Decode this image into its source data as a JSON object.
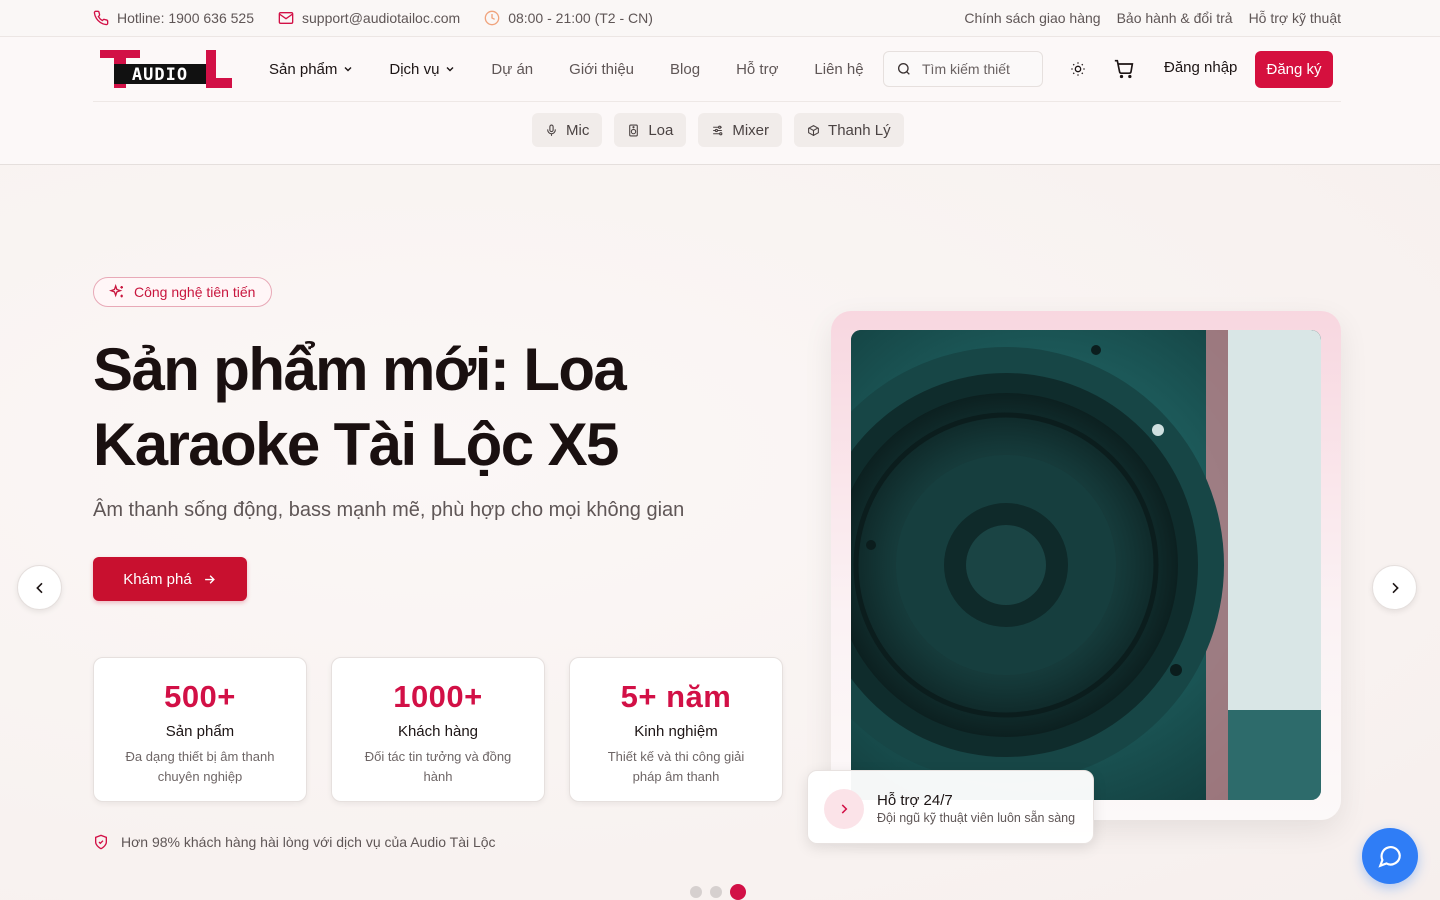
{
  "topbar": {
    "hotline": "Hotline: 1900 636 525",
    "email": "support@audiotailoc.com",
    "hours": "08:00 - 21:00 (T2 - CN)",
    "links": [
      "Chính sách giao hàng",
      "Bảo hành & đổi trả",
      "Hỗ trợ kỹ thuật"
    ]
  },
  "logo": {
    "text": "AUDIO"
  },
  "nav": {
    "items": [
      "Sản phẩm",
      "Dịch vụ",
      "Dự án",
      "Giới thiệu",
      "Blog",
      "Hỗ trợ",
      "Liên hệ"
    ]
  },
  "search": {
    "placeholder": "Tìm kiếm thiết"
  },
  "auth": {
    "login": "Đăng nhập",
    "signup": "Đăng ký"
  },
  "subnav": [
    "Mic",
    "Loa",
    "Mixer",
    "Thanh Lý"
  ],
  "hero": {
    "badge": "Công nghệ tiên tiến",
    "title": "Sản phẩm mới: Loa Karaoke Tài Lộc X5",
    "subtitle": "Âm thanh sống động, bass mạnh mẽ, phù hợp cho mọi không gian",
    "cta": "Khám phá",
    "trust": "Hơn 98% khách hàng hài lòng với dịch vụ của Audio Tài Lộc"
  },
  "stats": [
    {
      "value": "500+",
      "title": "Sản phẩm",
      "desc": "Đa dạng thiết bị âm thanh chuyên nghiệp"
    },
    {
      "value": "1000+",
      "title": "Khách hàng",
      "desc": "Đối tác tin tưởng và đồng hành"
    },
    {
      "value": "5+ năm",
      "title": "Kinh nghiệm",
      "desc": "Thiết kế và thi công giải pháp âm thanh"
    }
  ],
  "support_card": {
    "title": "Hỗ trợ 24/7",
    "desc": "Đội ngũ kỹ thuật viên luôn sẵn sàng"
  },
  "carousel": {
    "total": 3,
    "active": 3
  },
  "colors": {
    "accent": "#d21046",
    "chat": "#2f7df6"
  }
}
